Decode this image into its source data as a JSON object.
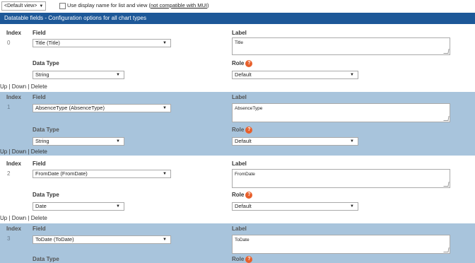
{
  "topbar": {
    "view_select": "<Default view>",
    "checkbox_label": "Use display name for list and view (",
    "checkbox_link": "not compatible with MUI",
    "checkbox_close": ")"
  },
  "header": {
    "title": "Datatable fields - Configuration options for all chart types"
  },
  "labels": {
    "index": "Index",
    "field": "Field",
    "label": "Label",
    "data_type": "Data Type",
    "role": "Role",
    "help_glyph": "?"
  },
  "actions": {
    "up": "Up",
    "sep1": " | ",
    "down": "Down",
    "sep2": " | ",
    "delete": "Delete"
  },
  "rows": [
    {
      "index": "0",
      "field": "Title (Title)",
      "label": "Title",
      "data_type": "String",
      "role": "Default"
    },
    {
      "index": "1",
      "field": "AbsenceType (AbsenceType)",
      "label": "AbsenceType",
      "data_type": "String",
      "role": "Default"
    },
    {
      "index": "2",
      "field": "FromDate (FromDate)",
      "label": "FromDate",
      "data_type": "Date",
      "role": "Default"
    },
    {
      "index": "3",
      "field": "ToDate (ToDate)",
      "label": "ToDate",
      "data_type": "",
      "role": ""
    }
  ],
  "colors": {
    "header_bg": "#1d5898",
    "row_shade": "#a8c4dc",
    "help_icon": "#e8602c"
  },
  "icons": {
    "help": "question-circle-icon",
    "dropdown": "chevron-down-icon"
  }
}
